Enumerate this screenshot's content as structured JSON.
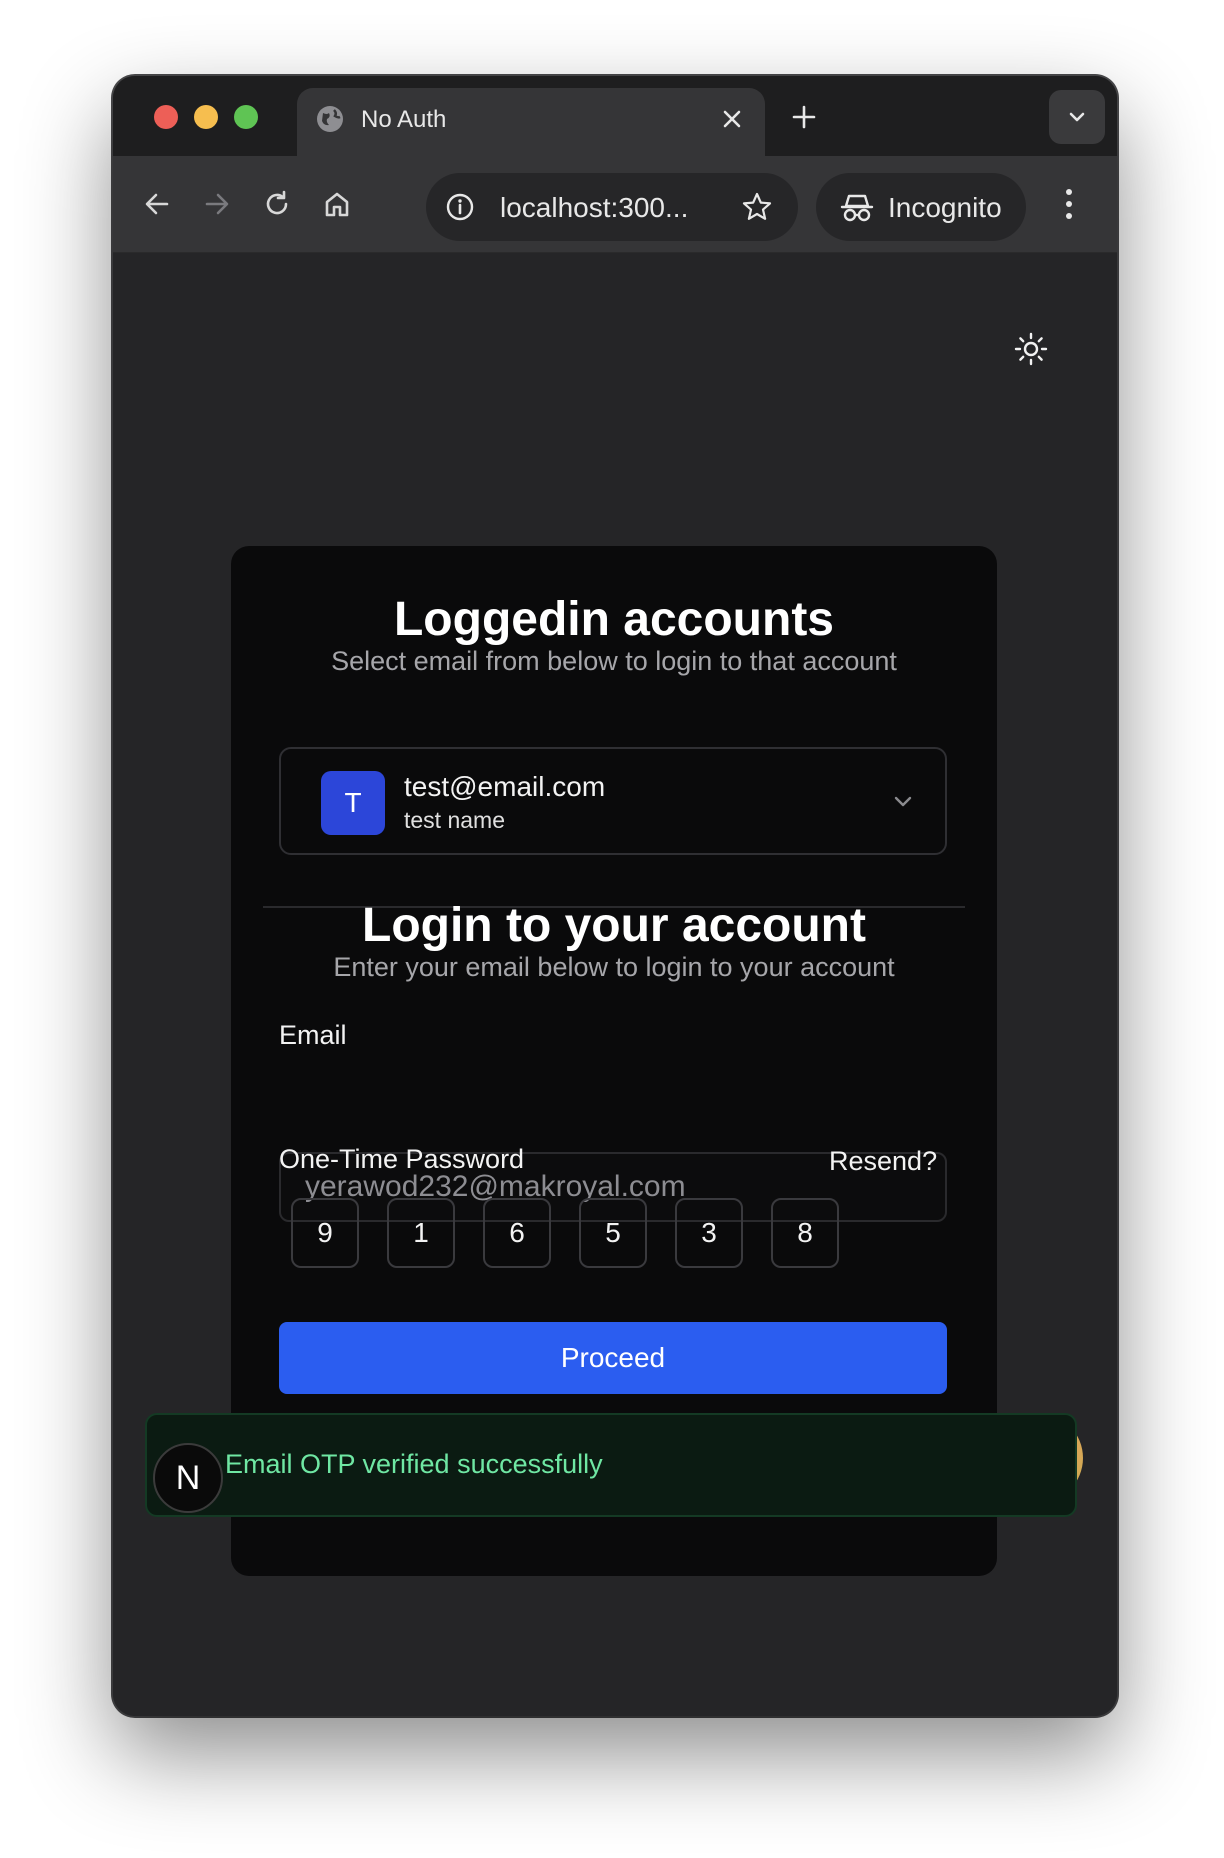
{
  "browser": {
    "tab_title": "No Auth",
    "url": "localhost:300...",
    "profile_label": "Incognito"
  },
  "card": {
    "accounts_title": "Loggedin accounts",
    "accounts_subtitle": "Select email from below to login to that account",
    "account": {
      "avatar_letter": "T",
      "email": "test@email.com",
      "name": "test name"
    },
    "login_title": "Login to your account",
    "login_subtitle": "Enter your email below to login to your account",
    "email_label": "Email",
    "email_value": "yerawod232@makroyal.com",
    "otp_label": "One-Time Password",
    "resend_label": "Resend?",
    "otp_digits": [
      "9",
      "1",
      "6",
      "5",
      "3",
      "8"
    ],
    "proceed_label": "Proceed"
  },
  "toast": {
    "message": "Email OTP verified successfully"
  },
  "dev_badge": {
    "letter": "N"
  },
  "colors": {
    "primary": "#2b5df0",
    "avatar": "#2c46d9",
    "success_text": "#6fe7a3"
  }
}
